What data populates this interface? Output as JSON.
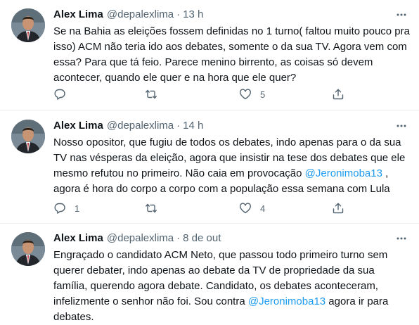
{
  "tweets": [
    {
      "name": "Alex Lima",
      "handle": "@depalexlima",
      "sep": "·",
      "time": "13 h",
      "text_parts": [
        {
          "text": "Se na Bahia as eleições fossem definidas no 1 turno( faltou muito pouco pra isso) ACM não teria ido aos debates, somente o da sua TV. Agora vem com essa? Para que tá feio. Parece menino birrento, as coisas só devem acontecer, quando ele quer e na hora que ele quer?"
        }
      ],
      "reply_count": "",
      "retweet_count": "",
      "like_count": "5"
    },
    {
      "name": "Alex Lima",
      "handle": "@depalexlima",
      "sep": "·",
      "time": "14 h",
      "text_parts": [
        {
          "text": "Nosso opositor, que fugiu de todos os debates, indo apenas para o da sua TV nas vésperas da eleição, agora que insistir na tese dos debates que ele mesmo refutou no primeiro. Não caia em provocação "
        },
        {
          "text": "@Jeronimoba13",
          "mention": true
        },
        {
          "text": " , agora é hora do corpo a corpo com a população essa semana com Lula"
        }
      ],
      "reply_count": "1",
      "retweet_count": "",
      "like_count": "4"
    },
    {
      "name": "Alex Lima",
      "handle": "@depalexlima",
      "sep": "·",
      "time": "8 de out",
      "text_parts": [
        {
          "text": "Engraçado o candidato ACM Neto, que passou todo primeiro turno sem querer debater, indo apenas ao debate da TV de propriedade da sua família, querendo agora debate. Candidato, os debates aconteceram, infelizmente o senhor não foi. Sou contra "
        },
        {
          "text": "@Jeronimoba13",
          "mention": true
        },
        {
          "text": " agora ir para debates."
        }
      ],
      "reply_count": "",
      "retweet_count": "",
      "like_count": ""
    }
  ],
  "icons": {
    "reply": "reply-icon",
    "retweet": "retweet-icon",
    "like": "heart-icon",
    "share": "share-icon",
    "more": "more-options-icon"
  },
  "colors": {
    "text": "#0f1419",
    "secondary": "#536471",
    "mention": "#1d9bf0",
    "divider": "#eff3f4"
  }
}
